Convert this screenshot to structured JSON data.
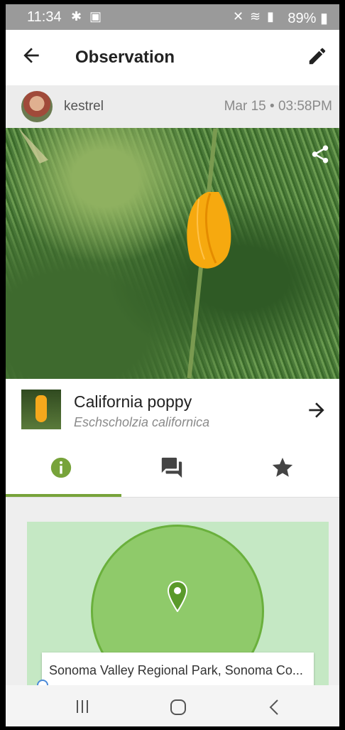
{
  "status_bar": {
    "time": "11:34",
    "notification_icons": [
      "bug-icon",
      "image-icon"
    ],
    "system_icons": [
      "mute-icon",
      "wifi-icon",
      "signal-icon"
    ],
    "battery": "89%"
  },
  "app_bar": {
    "title": "Observation",
    "back_icon": "arrow-left-icon",
    "edit_icon": "pencil-icon"
  },
  "observer": {
    "username": "kestrel",
    "date": "Mar 15 • 03:58PM"
  },
  "photo": {
    "share_icon": "share-icon"
  },
  "taxon": {
    "common_name": "California poppy",
    "scientific_name": "Eschscholzia californica"
  },
  "tabs": [
    {
      "name": "info",
      "icon": "info-icon",
      "active": true
    },
    {
      "name": "comments",
      "icon": "chat-icon",
      "active": false
    },
    {
      "name": "favorites",
      "icon": "star-icon",
      "active": false
    }
  ],
  "map": {
    "location": "Sonoma Valley Regional Park, Sonoma Co..."
  },
  "colors": {
    "accent": "#77a33a",
    "map_bg": "#c5e8c4",
    "accuracy_circle": "#8fca6a",
    "pin": "#5a9a2a"
  }
}
